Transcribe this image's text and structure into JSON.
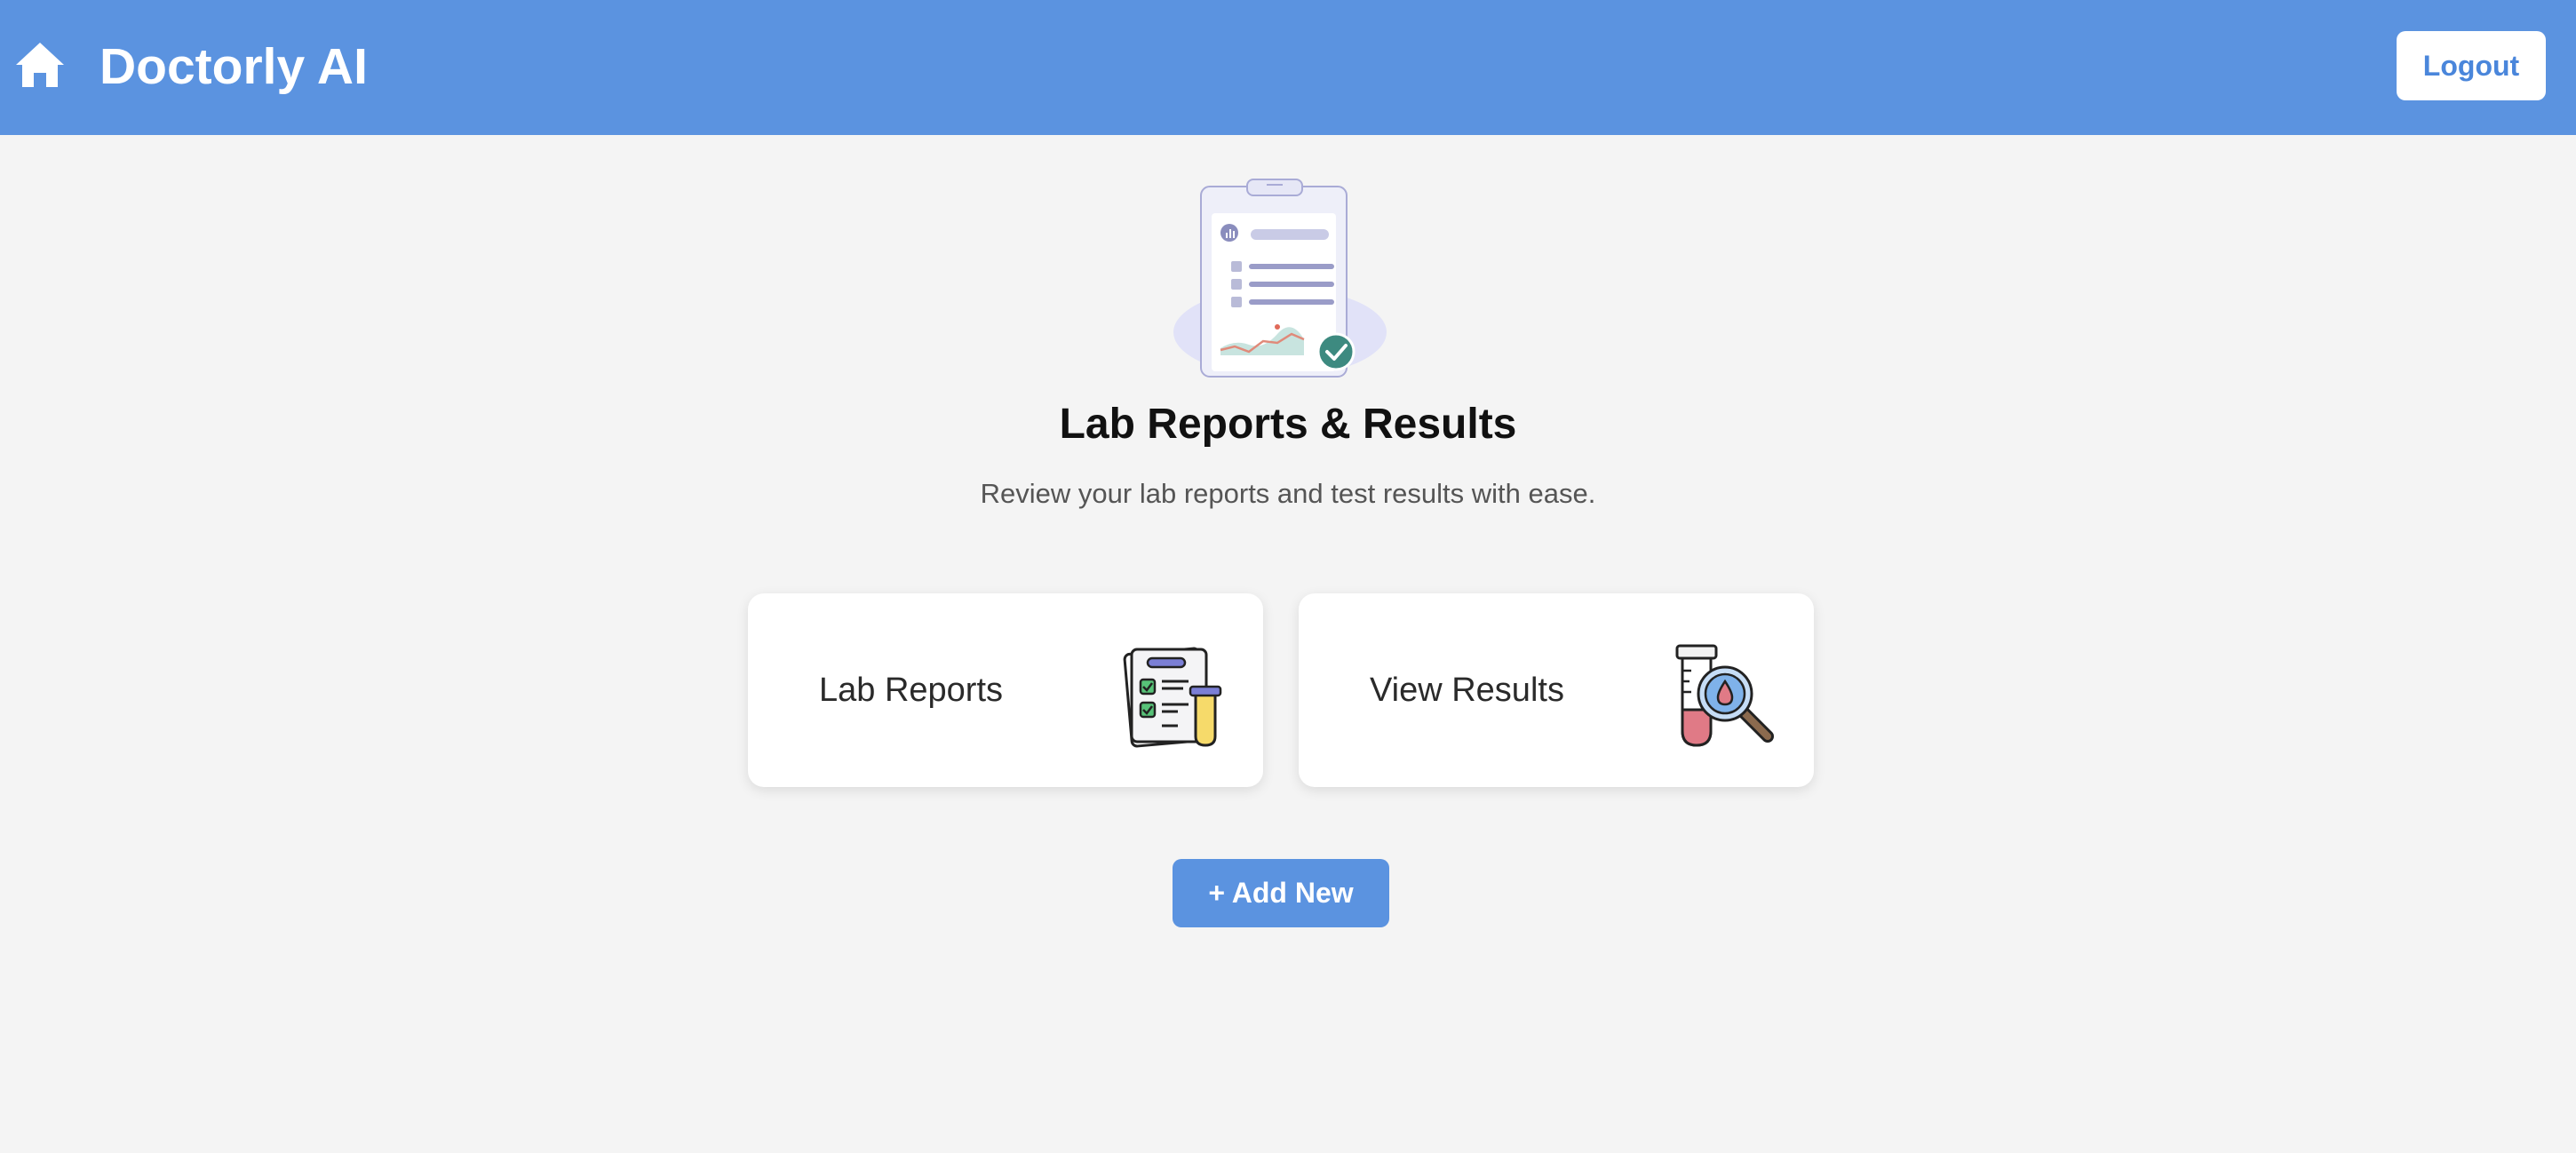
{
  "header": {
    "brand": "Doctorly AI",
    "home_icon": "home-icon",
    "logout_label": "Logout",
    "background": "#5b93e0"
  },
  "main": {
    "hero_icon": "clipboard-report-illustration",
    "title": "Lab Reports & Results",
    "subtitle": "Review your lab reports and test results with ease.",
    "cards": [
      {
        "label": "Lab Reports",
        "icon": "lab-reports-icon"
      },
      {
        "label": "View Results",
        "icon": "test-tube-magnifier-icon"
      }
    ],
    "add_new_label": "+ Add New"
  },
  "colors": {
    "accent": "#5b93e0",
    "page_background": "#f4f4f4",
    "card_background": "#ffffff"
  }
}
